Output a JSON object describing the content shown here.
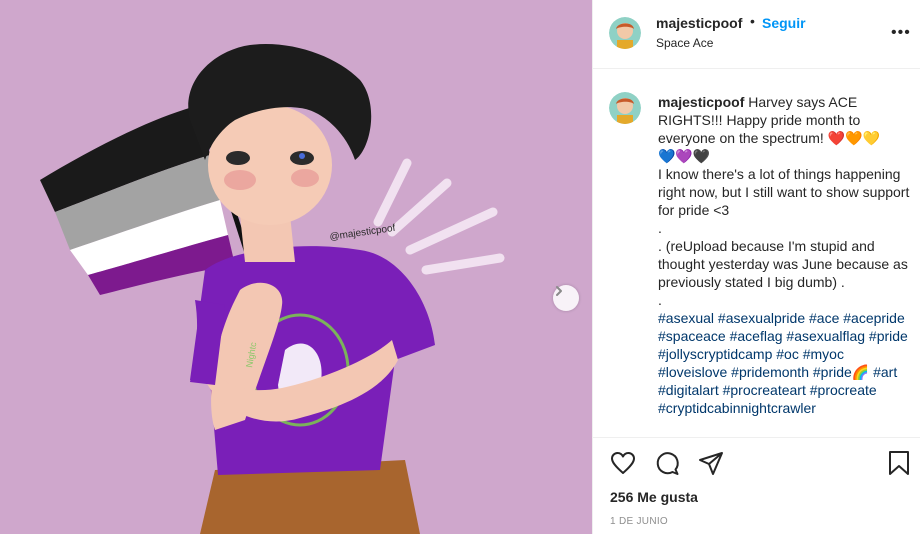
{
  "post": {
    "username": "majesticpoof",
    "follow_label": "Seguir",
    "location": "Space Ace",
    "image_watermark": "@majesticpoof",
    "shirt_text": "Nightc"
  },
  "caption": {
    "username": "majesticpoof",
    "line1": "Harvey says ACE RIGHTS!!! Happy pride month to everyone on the spectrum! ❤️🧡💛",
    "line2": "💙💜🖤",
    "line3": "I know there's a lot of things happening right now, but I still want to show support for pride <3",
    "dot1": ".",
    "line4": ". (reUpload because I'm stupid and thought yesterday was June because as previously stated I big dumb) .",
    "dot2": ".",
    "hashtags": "#asexual #asexualpride #ace #acepride #spaceace #aceflag #asexualflag #pride #jollyscryptidcamp #oc #myoc #loveislove #pridemonth #pride🌈 #art #digitalart #procreateart #procreate #cryptidcabinnightcrawler",
    "trail": "."
  },
  "stats": {
    "likes": "256 Me gusta",
    "date": "1 DE JUNIO"
  },
  "icons": {
    "more": "more-options-icon",
    "like": "heart-icon",
    "comment": "comment-icon",
    "share": "share-icon",
    "save": "bookmark-icon",
    "next": "chevron-right-icon"
  },
  "colors": {
    "background_image": "#cfa7cc",
    "link_blue": "#0095f6",
    "hashtag": "#00376b",
    "shirt": "#7a1fb8"
  }
}
